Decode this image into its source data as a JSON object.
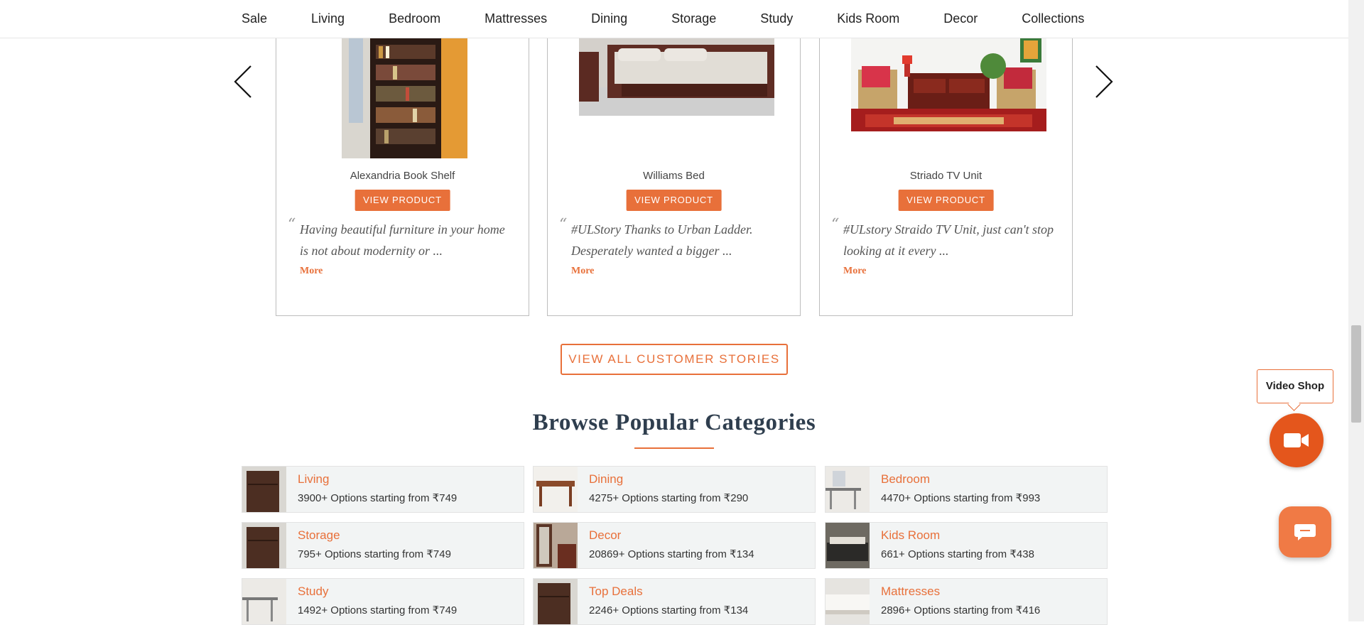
{
  "nav": {
    "items": [
      "Sale",
      "Living",
      "Bedroom",
      "Mattresses",
      "Dining",
      "Storage",
      "Study",
      "Kids Room",
      "Decor",
      "Collections"
    ]
  },
  "stories": [
    {
      "product": "Alexandria Book Shelf",
      "button": "VIEW PRODUCT",
      "quote_mark": "“",
      "quote": "Having beautiful furniture in your home is not about modernity or ...",
      "more": "More"
    },
    {
      "product": "Williams Bed",
      "button": "VIEW PRODUCT",
      "quote_mark": "“",
      "quote": "#ULStory Thanks to Urban Ladder. Desperately wanted a bigger ...",
      "more": "More"
    },
    {
      "product": "Striado TV Unit",
      "button": "VIEW PRODUCT",
      "quote_mark": "“",
      "quote": "#ULstory Straido TV Unit, just can't stop looking at it every ...",
      "more": "More"
    }
  ],
  "view_all": "VIEW ALL CUSTOMER STORIES",
  "section_title": "Browse Popular Categories",
  "categories": [
    {
      "name": "Living",
      "desc": "3900+ Options starting from ₹749"
    },
    {
      "name": "Dining",
      "desc": "4275+ Options starting from ₹290"
    },
    {
      "name": "Bedroom",
      "desc": "4470+ Options starting from ₹993"
    },
    {
      "name": "Storage",
      "desc": "795+ Options starting from ₹749"
    },
    {
      "name": "Decor",
      "desc": "20869+ Options starting from ₹134"
    },
    {
      "name": "Kids Room",
      "desc": "661+ Options starting from ₹438"
    },
    {
      "name": "Study",
      "desc": "1492+ Options starting from ₹749"
    },
    {
      "name": "Top Deals",
      "desc": "2246+ Options starting from ₹134"
    },
    {
      "name": "Mattresses",
      "desc": "2896+ Options starting from ₹416"
    }
  ],
  "video_shop": {
    "label": "Video Shop",
    "icon": "video-camera-icon"
  },
  "chat": {
    "icon": "chat-bubble-icon"
  },
  "colors": {
    "accent": "#e8703a",
    "video_button": "#e4561c",
    "title": "#2f3e4e",
    "category_bg": "#f2f4f4"
  }
}
